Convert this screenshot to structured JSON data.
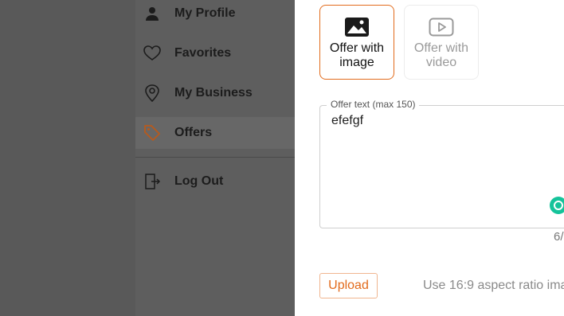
{
  "nav": {
    "items": [
      {
        "label": "My Profile",
        "icon": "person-icon"
      },
      {
        "label": "Favorites",
        "icon": "heart-icon"
      },
      {
        "label": "My Business",
        "icon": "location-pin-icon"
      },
      {
        "label": "Offers",
        "icon": "tag-icon",
        "active": true
      },
      {
        "label": "Log Out",
        "icon": "logout-icon"
      }
    ]
  },
  "offer_type": {
    "image_label": "Offer with image",
    "video_label": "Offer with video"
  },
  "offer_text": {
    "legend": "Offer text (max 150)",
    "value": "efefgf",
    "counter": "6/"
  },
  "upload": {
    "button_label": "Upload",
    "hint": "Use 16:9 aspect ratio ima"
  },
  "colors": {
    "accent": "#e26b1c",
    "overlay": "#595959",
    "grammarly": "#15c39a"
  }
}
